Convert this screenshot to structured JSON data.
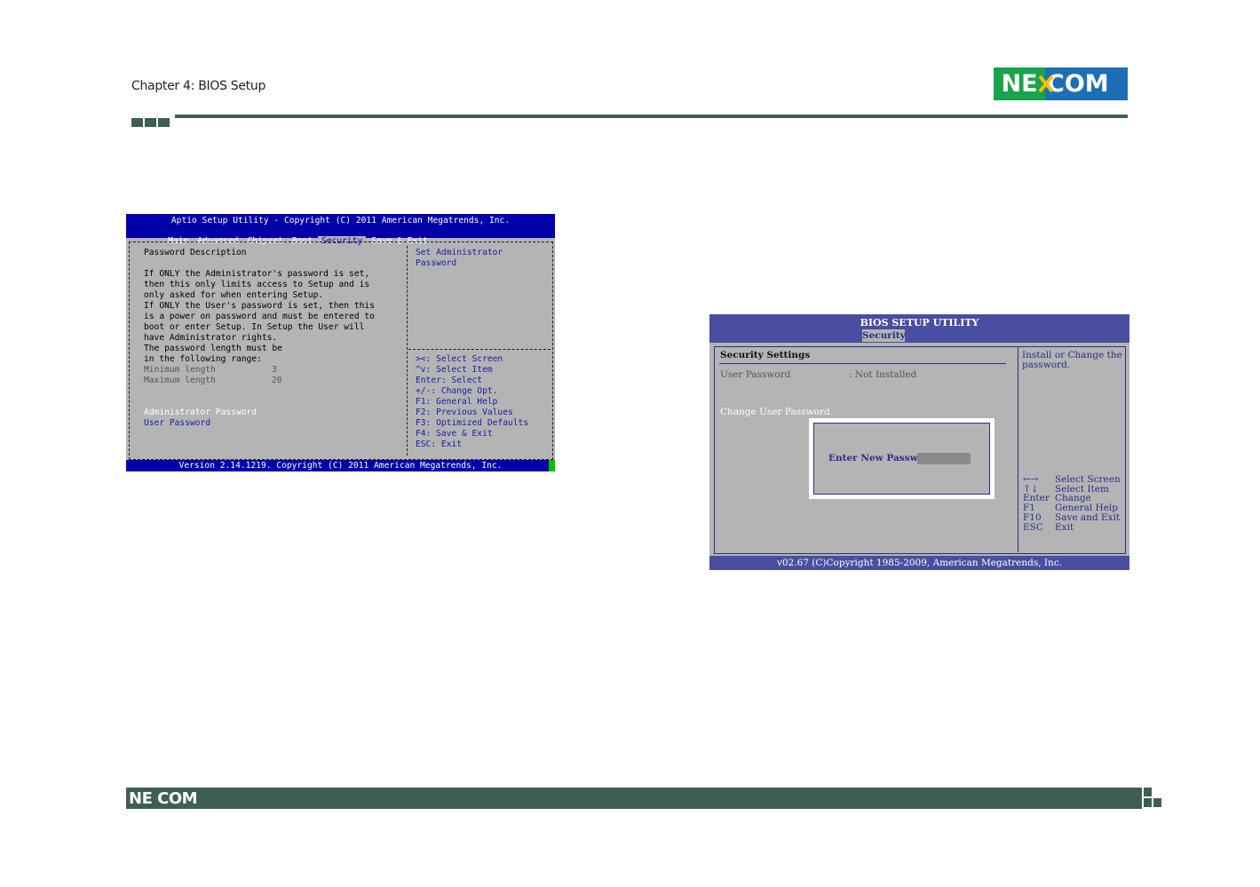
{
  "header": {
    "chapter": "Chapter 4: BIOS Setup",
    "logo": {
      "ne": "NE",
      "com": "COM",
      "green": "#1aa34a",
      "blue": "#1d6fb5"
    },
    "accent": "#3e5e55"
  },
  "aptio": {
    "title": "Aptio Setup Utility - Copyright (C) 2011 American Megatrends, Inc.",
    "tabs": [
      "Main",
      "Advanced",
      "Chipset",
      "Boot",
      "Security",
      "Save & Exit"
    ],
    "active_tab": "Security",
    "description": [
      "Password Description",
      "",
      "If ONLY the Administrator's password is set,",
      "then this only limits access to Setup and is",
      "only asked for when entering Setup.",
      "If ONLY the User's password is set, then this",
      "is a power on password and must be entered to",
      "boot or enter Setup. In Setup the User will",
      "have Administrator rights.",
      "The password length must be",
      "in the following range:"
    ],
    "min_label": "Minimum length",
    "min_value": "3",
    "max_label": "Maximum length",
    "max_value": "20",
    "admin_password": "Administrator Password",
    "user_password": "User Password",
    "help_title_1": "Set Administrator",
    "help_title_2": "Password",
    "keys": [
      "><: Select Screen",
      "^v: Select Item",
      "Enter: Select",
      "+/-: Change Opt.",
      "F1: General Help",
      "F2: Previous Values",
      "F3: Optimized Defaults",
      "F4: Save & Exit",
      "ESC: Exit"
    ],
    "footer": "Version 2.14.1219. Copyright (C) 2011 American Megatrends, Inc.",
    "blue": "#0000a8",
    "gray": "#b4b4b4"
  },
  "bios": {
    "title": "BIOS SETUP UTILITY",
    "tab": "Security",
    "section": "Security Settings",
    "user_password_label": "User Password",
    "user_password_value": ": Not Installed",
    "change_user_password": "Change User Password",
    "dialog_label": "Enter New Password",
    "help_1": "Install or Change the",
    "help_2": "password.",
    "keys": [
      {
        "key": "←→",
        "desc": "Select Screen"
      },
      {
        "key": "↑↓",
        "desc": "Select Item"
      },
      {
        "key": "Enter",
        "desc": "Change"
      },
      {
        "key": "F1",
        "desc": "General Help"
      },
      {
        "key": "F10",
        "desc": "Save and Exit"
      },
      {
        "key": "ESC",
        "desc": "Exit"
      }
    ],
    "footer": "v02.67 (C)Copyright 1985-2009, American Megatrends, Inc.",
    "purple": "#4a4ea0"
  },
  "footer": {
    "logo": "NE COM"
  }
}
